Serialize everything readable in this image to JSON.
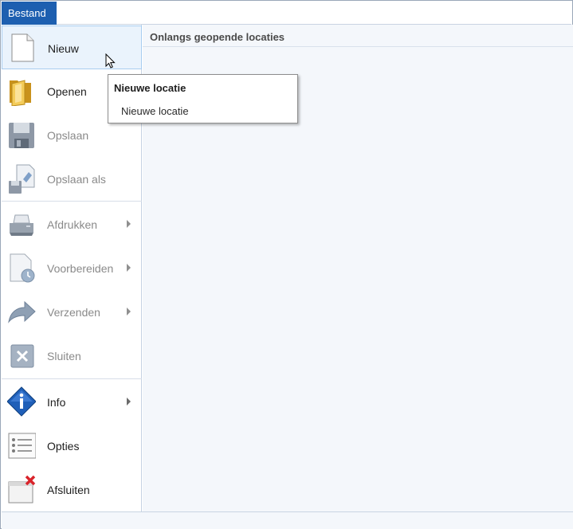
{
  "file_tab": {
    "label": "Bestand"
  },
  "menu": {
    "items": [
      {
        "id": "new",
        "label": "Nieuw",
        "icon": "new-document-icon",
        "state": "hover",
        "has_submenu": false
      },
      {
        "id": "open",
        "label": "Openen",
        "icon": "open-folder-icon",
        "state": "normal",
        "has_submenu": false
      },
      {
        "id": "save",
        "label": "Opslaan",
        "icon": "floppy-disk-icon",
        "state": "disabled",
        "has_submenu": false
      },
      {
        "id": "save-as",
        "label": "Opslaan als",
        "icon": "save-as-icon",
        "state": "disabled",
        "has_submenu": false
      },
      {
        "id": "print",
        "label": "Afdrukken",
        "icon": "printer-icon",
        "state": "disabled",
        "has_submenu": true
      },
      {
        "id": "prepare",
        "label": "Voorbereiden",
        "icon": "prepare-document-icon",
        "state": "disabled",
        "has_submenu": true
      },
      {
        "id": "send",
        "label": "Verzenden",
        "icon": "send-arrow-icon",
        "state": "disabled",
        "has_submenu": true
      },
      {
        "id": "close",
        "label": "Sluiten",
        "icon": "close-document-icon",
        "state": "disabled",
        "has_submenu": false
      },
      {
        "id": "info",
        "label": "Info",
        "icon": "info-icon",
        "state": "normal",
        "has_submenu": true
      },
      {
        "id": "options",
        "label": "Opties",
        "icon": "options-list-icon",
        "state": "normal",
        "has_submenu": false
      },
      {
        "id": "exit",
        "label": "Afsluiten",
        "icon": "exit-window-icon",
        "state": "normal",
        "has_submenu": false
      }
    ]
  },
  "content": {
    "title": "Onlangs geopende locaties"
  },
  "tooltip": {
    "title": "Nieuwe locatie",
    "body": "Nieuwe locatie"
  },
  "colors": {
    "file_tab": "#1d5fb0",
    "hover_bg": "#eaf3fc",
    "hover_border": "#a9cdf0",
    "content_bg": "#f4f7fb"
  }
}
